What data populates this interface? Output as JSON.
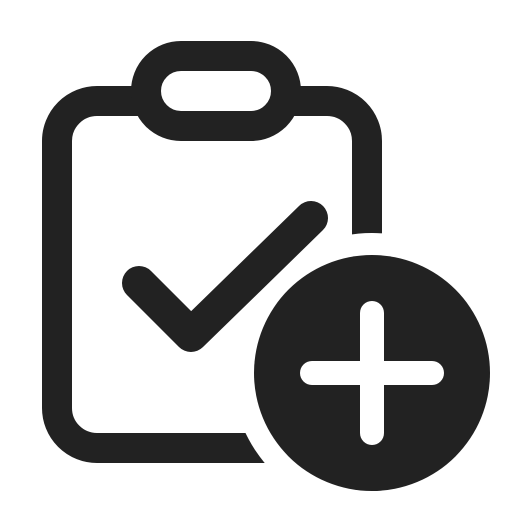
{
  "icon": {
    "name": "clipboard-check-add-icon",
    "parts": [
      "clipboard-icon",
      "clip-icon",
      "checkmark-icon",
      "add-badge-icon",
      "plus-icon"
    ],
    "colors": {
      "stroke": "#222222",
      "badge_fill": "#222222",
      "plus": "#ffffff",
      "background": "#ffffff"
    }
  }
}
